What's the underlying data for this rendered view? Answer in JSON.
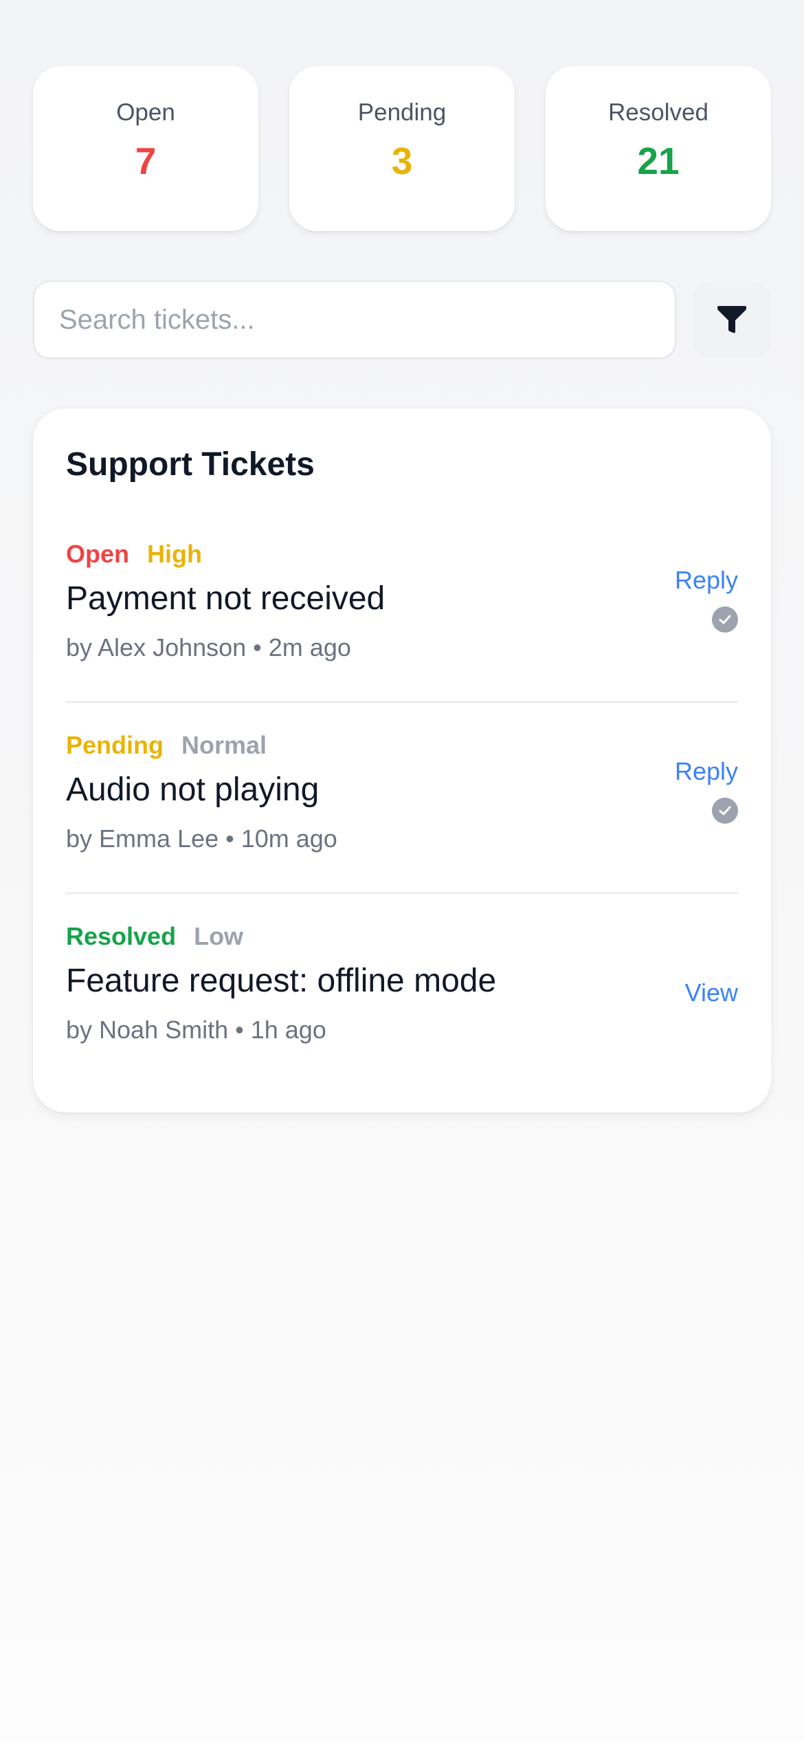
{
  "colors": {
    "open": "#ef4444",
    "pending": "#eab308",
    "resolved": "#16a34a",
    "high": "#eab308",
    "normal": "#9ca3af",
    "low": "#9ca3af",
    "link": "#3b82f6"
  },
  "stats": [
    {
      "label": "Open",
      "value": "7",
      "color": "#ef4444"
    },
    {
      "label": "Pending",
      "value": "3",
      "color": "#eab308"
    },
    {
      "label": "Resolved",
      "value": "21",
      "color": "#16a34a"
    }
  ],
  "search": {
    "placeholder": "Search tickets...",
    "filter_icon": "filter-funnel-icon"
  },
  "panel": {
    "title": "Support Tickets"
  },
  "tickets": [
    {
      "status": "Open",
      "priority": "High",
      "title": "Payment not received",
      "meta": "by Alex Johnson • 2m ago",
      "action": "Reply",
      "icon": "check-circle-icon"
    },
    {
      "status": "Pending",
      "priority": "Normal",
      "title": "Audio not playing",
      "meta": "by Emma Lee • 10m ago",
      "action": "Reply",
      "icon": "check-circle-icon"
    },
    {
      "status": "Resolved",
      "priority": "Low",
      "title": "Feature request: offline mode",
      "meta": "by Noah Smith • 1h ago",
      "action": "View"
    }
  ]
}
